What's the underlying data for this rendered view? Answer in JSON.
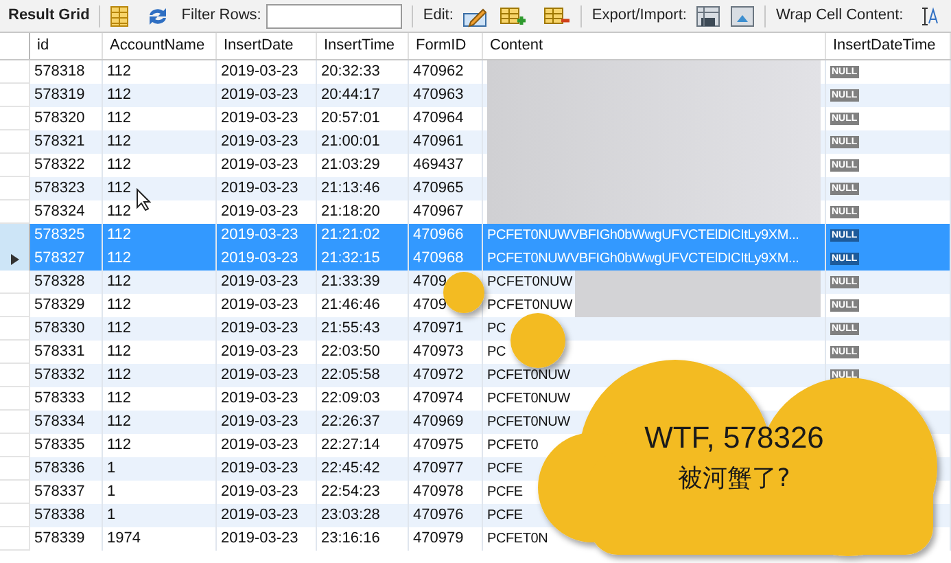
{
  "toolbar": {
    "title": "Result Grid",
    "filter_label": "Filter Rows:",
    "edit_label": "Edit:",
    "export_label": "Export/Import:",
    "wrap_label": "Wrap Cell Content:"
  },
  "columns": [
    "id",
    "AccountName",
    "InsertDate",
    "InsertTime",
    "FormID",
    "Content",
    "InsertDateTime"
  ],
  "rows": [
    {
      "cells": [
        "578318",
        "112",
        "2019-03-23",
        "20:32:33",
        "470962"
      ],
      "kind": "redacted",
      "null": "NULL",
      "selected": false,
      "current": false
    },
    {
      "cells": [
        "578319",
        "112",
        "2019-03-23",
        "20:44:17",
        "470963"
      ],
      "kind": "redacted",
      "null": "NULL",
      "selected": false,
      "current": false
    },
    {
      "cells": [
        "578320",
        "112",
        "2019-03-23",
        "20:57:01",
        "470964"
      ],
      "kind": "redacted",
      "null": "NULL",
      "selected": false,
      "current": false
    },
    {
      "cells": [
        "578321",
        "112",
        "2019-03-23",
        "21:00:01",
        "470961"
      ],
      "kind": "redacted",
      "null": "NULL",
      "selected": false,
      "current": false
    },
    {
      "cells": [
        "578322",
        "112",
        "2019-03-23",
        "21:03:29",
        "469437"
      ],
      "kind": "redacted",
      "null": "NULL",
      "selected": false,
      "current": false
    },
    {
      "cells": [
        "578323",
        "112",
        "2019-03-23",
        "21:13:46",
        "470965"
      ],
      "kind": "redacted",
      "null": "NULL",
      "selected": false,
      "current": false
    },
    {
      "cells": [
        "578324",
        "112",
        "2019-03-23",
        "21:18:20",
        "470967"
      ],
      "kind": "redacted",
      "null": "NULL",
      "selected": false,
      "current": false
    },
    {
      "cells": [
        "578325",
        "112",
        "2019-03-23",
        "21:21:02",
        "470966"
      ],
      "kind": "text",
      "content": "PCFET0NUWVBFIGh0bWwgUFVCTElDICItLy9XM...",
      "null": "NULL",
      "selected": true,
      "current": false
    },
    {
      "cells": [
        "578327",
        "112",
        "2019-03-23",
        "21:32:15",
        "470968"
      ],
      "kind": "text",
      "content": "PCFET0NUWVBFIGh0bWwgUFVCTElDICItLy9XM...",
      "null": "NULL",
      "selected": true,
      "current": true
    },
    {
      "cells": [
        "578328",
        "112",
        "2019-03-23",
        "21:33:39",
        "4709"
      ],
      "kind": "partial",
      "content": "PCFET0NUW",
      "null": "NULL",
      "selected": false,
      "current": false
    },
    {
      "cells": [
        "578329",
        "112",
        "2019-03-23",
        "21:46:46",
        "4709"
      ],
      "kind": "partial",
      "content": "PCFET0NUW",
      "null": "NULL",
      "selected": false,
      "current": false
    },
    {
      "cells": [
        "578330",
        "112",
        "2019-03-23",
        "21:55:43",
        "470971"
      ],
      "kind": "text",
      "content": "PC",
      "null": "NULL",
      "selected": false,
      "current": false
    },
    {
      "cells": [
        "578331",
        "112",
        "2019-03-23",
        "22:03:50",
        "470973"
      ],
      "kind": "text",
      "content": "PC",
      "null": "NULL",
      "selected": false,
      "current": false
    },
    {
      "cells": [
        "578332",
        "112",
        "2019-03-23",
        "22:05:58",
        "470972"
      ],
      "kind": "text",
      "content": "PCFET0NUW",
      "null": "NULL",
      "selected": false,
      "current": false
    },
    {
      "cells": [
        "578333",
        "112",
        "2019-03-23",
        "22:09:03",
        "470974"
      ],
      "kind": "text",
      "content": "PCFET0NUW",
      "selected": false,
      "current": false
    },
    {
      "cells": [
        "578334",
        "112",
        "2019-03-23",
        "22:26:37",
        "470969"
      ],
      "kind": "text",
      "content": "PCFET0NUW",
      "selected": false,
      "current": false
    },
    {
      "cells": [
        "578335",
        "112",
        "2019-03-23",
        "22:27:14",
        "470975"
      ],
      "kind": "text",
      "content": "PCFET0",
      "selected": false,
      "current": false
    },
    {
      "cells": [
        "578336",
        "1",
        "2019-03-23",
        "22:45:42",
        "470977"
      ],
      "kind": "text",
      "content": "PCFE",
      "selected": false,
      "current": false
    },
    {
      "cells": [
        "578337",
        "1",
        "2019-03-23",
        "22:54:23",
        "470978"
      ],
      "kind": "text",
      "content": "PCFE",
      "selected": false,
      "current": false
    },
    {
      "cells": [
        "578338",
        "1",
        "2019-03-23",
        "23:03:28",
        "470976"
      ],
      "kind": "text",
      "content": "PCFE",
      "selected": false,
      "current": false
    },
    {
      "cells": [
        "578339",
        "1974",
        "2019-03-23",
        "23:16:16",
        "470979"
      ],
      "kind": "text",
      "content": "PCFET0N",
      "selected": false,
      "current": false
    }
  ],
  "cloud": {
    "line_1": "WTF, 578326",
    "line_2": "被河蟹了?"
  }
}
